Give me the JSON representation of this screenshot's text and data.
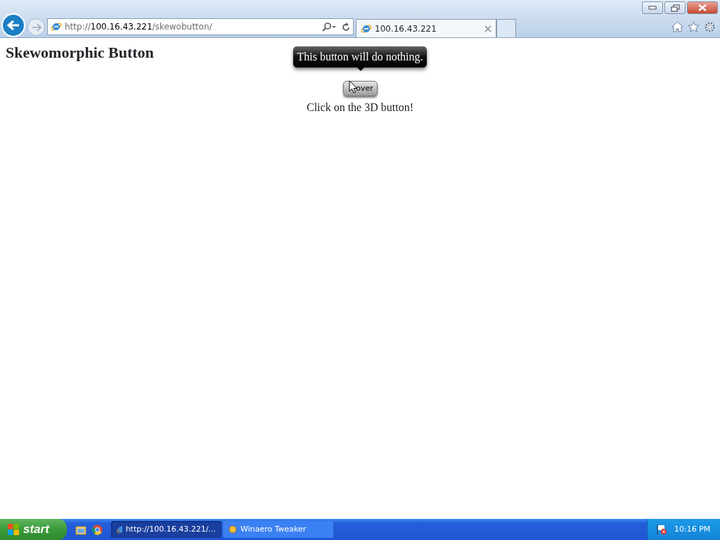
{
  "address_bar": {
    "scheme": "http://",
    "host": "100.16.43.221",
    "path": "/skewobutton/"
  },
  "tabs": [
    {
      "label": "100.16.43.221",
      "selected": true
    }
  ],
  "page": {
    "heading": "Skewomorphic Button",
    "tooltip": "This button will do nothing.",
    "button_label": "over",
    "caption": "Click on the 3D button!"
  },
  "taskbar": {
    "start": "start",
    "tasks": [
      {
        "label": "http://100.16.43.221/...",
        "selected": true
      },
      {
        "label": "Winaero Tweaker",
        "selected": false
      }
    ],
    "clock": "10:16 PM"
  }
}
